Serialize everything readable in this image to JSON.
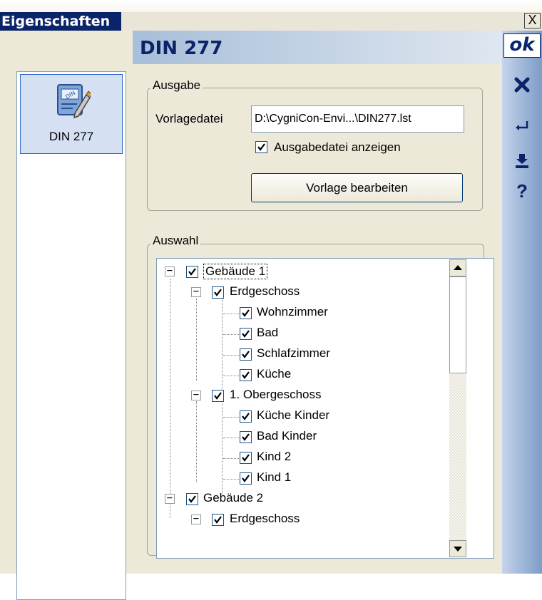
{
  "window": {
    "title": "Eigenschaften",
    "close_label": "X"
  },
  "nav": {
    "items": [
      {
        "label": "DIN 277",
        "icon": "document-edit-icon"
      }
    ]
  },
  "page": {
    "title": "DIN 277"
  },
  "ausgabe": {
    "group_label": "Ausgabe",
    "template_label": "Vorlagedatei",
    "template_value": "D:\\CygniCon-Envi...\\DIN277.lst",
    "show_output_label": "Ausgabedatei anzeigen",
    "show_output_checked": true,
    "edit_button": "Vorlage bearbeiten"
  },
  "auswahl": {
    "group_label": "Auswahl",
    "tree": [
      {
        "label": "Gebäude 1",
        "level": 0,
        "expander": "−",
        "checked": true
      },
      {
        "label": "Erdgeschoss",
        "level": 1,
        "expander": "−",
        "checked": true
      },
      {
        "label": "Wohnzimmer",
        "level": 2,
        "checked": true
      },
      {
        "label": "Bad",
        "level": 2,
        "checked": true
      },
      {
        "label": "Schlafzimmer",
        "level": 2,
        "checked": true
      },
      {
        "label": "Küche",
        "level": 2,
        "checked": true
      },
      {
        "label": "1. Obergeschoss",
        "level": 1,
        "expander": "−",
        "checked": true
      },
      {
        "label": "Küche Kinder",
        "level": 2,
        "checked": true
      },
      {
        "label": "Bad Kinder",
        "level": 2,
        "checked": true
      },
      {
        "label": "Kind 2",
        "level": 2,
        "checked": true
      },
      {
        "label": "Kind 1",
        "level": 2,
        "checked": true
      },
      {
        "label": "Gebäude 2",
        "level": 0,
        "expander": "−",
        "checked": true
      },
      {
        "label": "Erdgeschoss",
        "level": 1,
        "expander": "−",
        "checked": true
      }
    ]
  },
  "actions": {
    "ok_label": "ok",
    "cancel_icon": "x-icon",
    "apply_icon": "return-arrow-icon",
    "save_icon": "save-icon",
    "help_label": "?"
  }
}
